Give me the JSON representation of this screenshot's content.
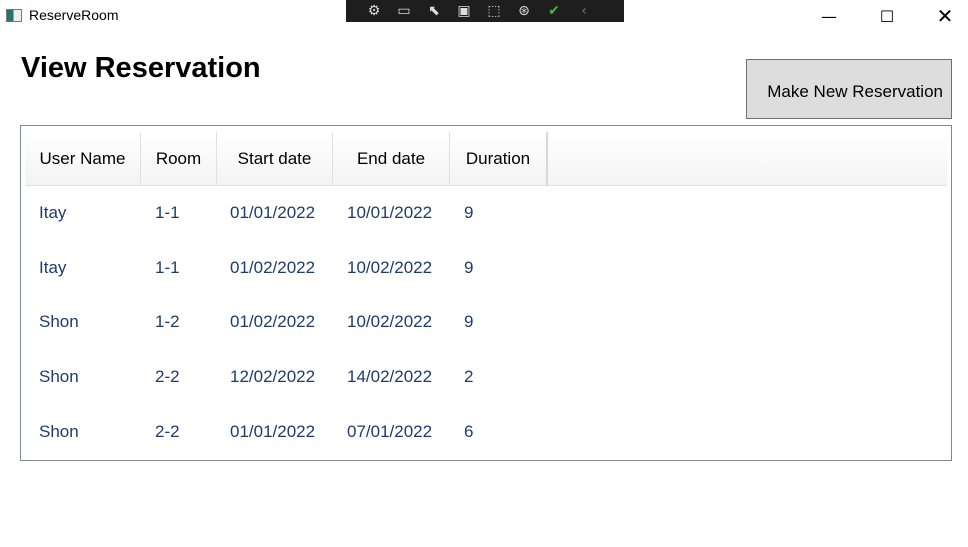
{
  "window": {
    "title": "ReserveRoom"
  },
  "page": {
    "title": "View Reservation",
    "new_button": "Make New Reservation"
  },
  "table": {
    "columns": [
      "User Name",
      "Room",
      "Start date",
      "End date",
      "Duration"
    ],
    "rows": [
      [
        "Itay",
        "1-1",
        "01/01/2022",
        "10/01/2022",
        "9"
      ],
      [
        "Itay",
        "1-1",
        "01/02/2022",
        "10/02/2022",
        "9"
      ],
      [
        "Shon",
        "1-2",
        "01/02/2022",
        "10/02/2022",
        "9"
      ],
      [
        "Shon",
        "2-2",
        "12/02/2022",
        "14/02/2022",
        "2"
      ],
      [
        "Shon",
        "2-2",
        "01/01/2022",
        "07/01/2022",
        "6"
      ]
    ]
  },
  "colors": {
    "cell_text": "#1f3a6e",
    "button_bg": "#dddddd"
  }
}
